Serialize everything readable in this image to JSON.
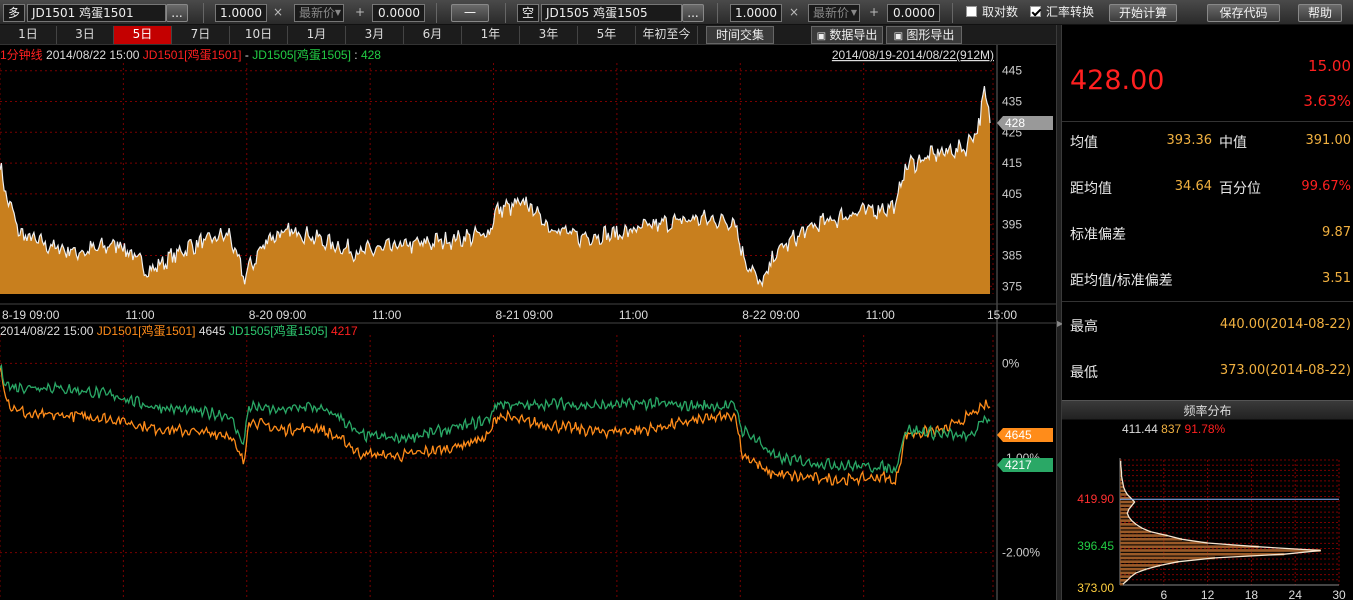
{
  "toolbar": {
    "long_side": "多",
    "long_symbol": "JD1501  鸡蛋1501",
    "dots": "...",
    "long_ratio": "1.0000",
    "times": "×",
    "price_type": "最新价",
    "plus": "+",
    "long_offset": "0.0000",
    "operator": "一",
    "short_side": "空",
    "short_symbol": "JD1505  鸡蛋1505",
    "short_ratio": "1.0000",
    "short_offset": "0.0000",
    "reciprocal_label": "取对数",
    "reciprocal_checked": false,
    "fx_label": "汇率转换",
    "fx_checked": true,
    "calc_button": "开始计算",
    "save_button": "保存代码",
    "help_button": "帮助"
  },
  "tabs": [
    "1日",
    "3日",
    "5日",
    "7日",
    "10日",
    "1月",
    "3月",
    "6月",
    "1年",
    "3年",
    "5年",
    "年初至今"
  ],
  "active_tab": "5日",
  "tab_buttons": {
    "time_cross": "时间交集",
    "export_data": "数据导出",
    "export_image": "图形导出"
  },
  "spread_panel": {
    "period": "1分钟线",
    "timestamp": "2014/08/22 15:00",
    "formula_a": "JD1501[鸡蛋1501]",
    "formula_op": " - ",
    "formula_b": "JD1505[鸡蛋1505]",
    "formula_eq": " : ",
    "value": "428",
    "range": "2014/08/19-2014/08/22(912M)",
    "current_tag": "428",
    "colors": {
      "fill": "#c87f1e",
      "line": "#f0f0f0",
      "grid": "#7a0000",
      "red": "#ff2020",
      "green": "#22cc44"
    }
  },
  "x_ticks": [
    "8-19 09:00",
    "11:00",
    "8-20 09:00",
    "11:00",
    "8-21 09:00",
    "11:00",
    "8-22 09:00",
    "11:00",
    "15:00"
  ],
  "compare_panel": {
    "timestamp": "2014/08/22 15:00",
    "a_label": "JD1501[鸡蛋1501]",
    "a_value": "4645",
    "b_label": "JD1505[鸡蛋1505]",
    "b_value": "4217",
    "a_color": "#ff8c1a",
    "b_color": "#2aa866",
    "a_tag": "4645",
    "b_tag": "4217"
  },
  "quote": {
    "last": "428.00",
    "change": "15.00",
    "change_pct": "3.63%"
  },
  "stats": {
    "mean_label": "均值",
    "mean": "393.36",
    "median_label": "中值",
    "median": "391.00",
    "dev_label": "距均值",
    "dev": "34.64",
    "pctile_label": "百分位",
    "pctile": "99.67%",
    "std_label": "标准偏差",
    "std": "9.87",
    "zscore_label": "距均值/标准偏差",
    "zscore": "3.51",
    "high_label": "最高",
    "high": "440.00(2014-08-22)",
    "low_label": "最低",
    "low": "373.00(2014-08-22)"
  },
  "distribution": {
    "title": "频率分布",
    "cursor_price": "411.44",
    "cursor_count": "837",
    "cursor_pct": "91.78%"
  },
  "chart_data": [
    {
      "type": "area",
      "name": "spread",
      "x_ticks": [
        "8-19 09:00",
        "11:00",
        "8-20 09:00",
        "11:00",
        "8-21 09:00",
        "11:00",
        "8-22 09:00",
        "11:00",
        "15:00"
      ],
      "y_ticks": [
        375,
        385,
        395,
        405,
        415,
        425,
        435,
        445
      ],
      "ylim": [
        372.5,
        447.5
      ],
      "grid": true,
      "key_points": [
        [
          0,
          415
        ],
        [
          0.004,
          407
        ],
        [
          0.02,
          392
        ],
        [
          0.05,
          388
        ],
        [
          0.08,
          386
        ],
        [
          0.12,
          389
        ],
        [
          0.15,
          380
        ],
        [
          0.19,
          388
        ],
        [
          0.23,
          392
        ],
        [
          0.245,
          378
        ],
        [
          0.27,
          391
        ],
        [
          0.3,
          393
        ],
        [
          0.33,
          389
        ],
        [
          0.36,
          386
        ],
        [
          0.4,
          388
        ],
        [
          0.45,
          390
        ],
        [
          0.49,
          392
        ],
        [
          0.5,
          400
        ],
        [
          0.53,
          402
        ],
        [
          0.55,
          395
        ],
        [
          0.58,
          391
        ],
        [
          0.62,
          392
        ],
        [
          0.66,
          395
        ],
        [
          0.7,
          397
        ],
        [
          0.74,
          396
        ],
        [
          0.745,
          386
        ],
        [
          0.76,
          378
        ],
        [
          0.765,
          375
        ],
        [
          0.78,
          386
        ],
        [
          0.8,
          391
        ],
        [
          0.82,
          395
        ],
        [
          0.86,
          399
        ],
        [
          0.9,
          401
        ],
        [
          0.91,
          414
        ],
        [
          0.94,
          418
        ],
        [
          0.97,
          420
        ],
        [
          0.985,
          428
        ],
        [
          0.989,
          440
        ],
        [
          0.995,
          428
        ]
      ]
    },
    {
      "type": "line",
      "name": "legs",
      "y_ticks": [
        "0%",
        "-1.00%",
        "-2.00%"
      ],
      "ylim_pct": [
        -2.5,
        0.3
      ],
      "series": [
        {
          "name": "JD1501[鸡蛋1501]",
          "key_points": [
            [
              0,
              -0.05
            ],
            [
              0.008,
              -0.4
            ],
            [
              0.01,
              -0.45
            ],
            [
              0.03,
              -0.55
            ],
            [
              0.08,
              -0.55
            ],
            [
              0.12,
              -0.6
            ],
            [
              0.15,
              -0.68
            ],
            [
              0.19,
              -0.72
            ],
            [
              0.23,
              -0.75
            ],
            [
              0.245,
              -1.05
            ],
            [
              0.25,
              -0.6
            ],
            [
              0.28,
              -0.7
            ],
            [
              0.32,
              -0.68
            ],
            [
              0.35,
              -0.85
            ],
            [
              0.36,
              -0.95
            ],
            [
              0.4,
              -0.98
            ],
            [
              0.45,
              -0.9
            ],
            [
              0.49,
              -0.78
            ],
            [
              0.5,
              -0.55
            ],
            [
              0.53,
              -0.62
            ],
            [
              0.55,
              -0.65
            ],
            [
              0.6,
              -0.72
            ],
            [
              0.65,
              -0.7
            ],
            [
              0.7,
              -0.6
            ],
            [
              0.74,
              -0.55
            ],
            [
              0.745,
              -0.95
            ],
            [
              0.76,
              -1.05
            ],
            [
              0.77,
              -1.15
            ],
            [
              0.8,
              -1.2
            ],
            [
              0.85,
              -1.23
            ],
            [
              0.89,
              -1.2
            ],
            [
              0.9,
              -1.27
            ],
            [
              0.91,
              -0.75
            ],
            [
              0.95,
              -0.7
            ],
            [
              0.975,
              -0.55
            ],
            [
              0.99,
              -0.45
            ]
          ]
        },
        {
          "name": "JD1505[鸡蛋1505]",
          "key_points": [
            [
              0,
              -0.05
            ],
            [
              0.006,
              -0.2
            ],
            [
              0.01,
              -0.25
            ],
            [
              0.05,
              -0.25
            ],
            [
              0.09,
              -0.3
            ],
            [
              0.12,
              -0.35
            ],
            [
              0.15,
              -0.45
            ],
            [
              0.19,
              -0.5
            ],
            [
              0.23,
              -0.55
            ],
            [
              0.245,
              -0.85
            ],
            [
              0.25,
              -0.45
            ],
            [
              0.28,
              -0.5
            ],
            [
              0.31,
              -0.45
            ],
            [
              0.34,
              -0.55
            ],
            [
              0.36,
              -0.75
            ],
            [
              0.4,
              -0.8
            ],
            [
              0.45,
              -0.7
            ],
            [
              0.49,
              -0.6
            ],
            [
              0.5,
              -0.42
            ],
            [
              0.53,
              -0.45
            ],
            [
              0.55,
              -0.42
            ],
            [
              0.6,
              -0.45
            ],
            [
              0.65,
              -0.42
            ],
            [
              0.7,
              -0.45
            ],
            [
              0.74,
              -0.45
            ],
            [
              0.745,
              -0.7
            ],
            [
              0.76,
              -0.8
            ],
            [
              0.78,
              -1.0
            ],
            [
              0.82,
              -1.05
            ],
            [
              0.85,
              -1.08
            ],
            [
              0.89,
              -1.1
            ],
            [
              0.9,
              -1.12
            ],
            [
              0.91,
              -0.7
            ],
            [
              0.95,
              -0.75
            ],
            [
              0.975,
              -0.78
            ],
            [
              0.99,
              -0.58
            ]
          ]
        }
      ]
    },
    {
      "type": "bar",
      "name": "frequency-distribution",
      "orientation": "horizontal",
      "y_ticks": [
        "419.90",
        "396.45",
        "373.00"
      ],
      "x_ticks": [
        "6",
        "12",
        "18",
        "24",
        "30"
      ],
      "xlim": [
        0,
        30
      ],
      "bin_centers": [
        373.5,
        375.5,
        377.5,
        379.5,
        381.5,
        383.5,
        385.5,
        387.5,
        389.5,
        391.5,
        393.5,
        395.5,
        397.5,
        399.5,
        401.5,
        403.5,
        405.5,
        407.5,
        409.5,
        411.5,
        413.5,
        415.5,
        417.5,
        419.5,
        421.5,
        423.5,
        425.5,
        427.5,
        429.5,
        431.5,
        433.5,
        435.5,
        437.5,
        439.5
      ],
      "values": [
        0.4,
        1.0,
        1.5,
        2.2,
        3.6,
        5.5,
        8.0,
        13.0,
        22.5,
        27.5,
        19.0,
        12.0,
        8.5,
        6.5,
        4.2,
        3.0,
        2.2,
        1.6,
        1.2,
        1.0,
        1.2,
        1.6,
        2.0,
        1.5,
        1.0,
        0.7,
        0.5,
        0.4,
        0.3,
        0.2,
        0.2,
        0.15,
        0.1,
        0.1
      ]
    }
  ]
}
